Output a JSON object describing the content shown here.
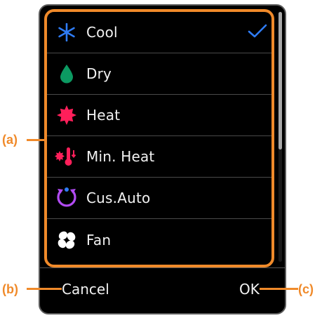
{
  "mode_list": {
    "items": [
      {
        "label": "Cool",
        "icon": "snowflake-icon",
        "color": "#2f7cf6",
        "selected": true
      },
      {
        "label": "Dry",
        "icon": "droplet-icon",
        "color": "#0c9a62",
        "selected": false
      },
      {
        "label": "Heat",
        "icon": "sun-icon",
        "color": "#ff1f5a",
        "selected": false
      },
      {
        "label": "Min. Heat",
        "icon": "min-heat-thermometer-icon",
        "color": "#ff1f5a",
        "selected": false
      },
      {
        "label": "Cus.Auto",
        "icon": "custom-auto-cycle-icon",
        "color": "#b24bf3",
        "selected": false
      },
      {
        "label": "Fan",
        "icon": "fan-icon",
        "color": "#ffffff",
        "selected": false
      }
    ],
    "check_color": "#2f7cf6"
  },
  "footer": {
    "cancel_label": "Cancel",
    "ok_label": "OK"
  },
  "callouts": {
    "a": "(a)",
    "b": "(b)",
    "c": "(c)",
    "color": "#f08a2a"
  }
}
